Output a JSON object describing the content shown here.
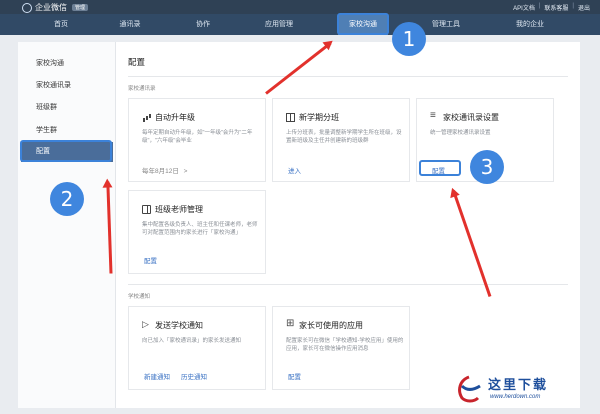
{
  "app": {
    "logo_text": "企业微信",
    "logo_badge": "管理",
    "top_links": [
      "API文档",
      "联系客服",
      "退出"
    ]
  },
  "nav": {
    "items": [
      "首页",
      "通讯录",
      "协作",
      "应用管理",
      "家校沟通",
      "管理工具",
      "我的企业"
    ],
    "active": "家校沟通"
  },
  "sidebar": {
    "items": [
      "家校沟通",
      "家校通讯录",
      "班级群",
      "学生群",
      "配置"
    ],
    "active": "配置"
  },
  "main": {
    "title": "配置",
    "section_contacts": "家校通讯录",
    "section_notice": "学校通知",
    "cards": {
      "promotion": {
        "title": "自动升年级",
        "desc": "每年定期自动升年级，如\"一年级\"会升为\"二年级\"，\"六年级\"会毕业",
        "foot": "每年8月12日",
        "foot_chevron": ">"
      },
      "class_split": {
        "title": "新学期分班",
        "desc": "上传分班表，批量调整新学期学生所在班级，设置新班级及主任并创建新的班级群",
        "link": "进入"
      },
      "contacts_settings": {
        "title": "家校通讯录设置",
        "desc": "统一管理家校通讯录设置",
        "link": "配置"
      },
      "class_teacher": {
        "title": "班级老师管理",
        "desc": "集中配置各级负责人、班主任和任课老师，老师可对配置范围内的家长进行「家校沟通」",
        "link": "配置"
      },
      "send_notice": {
        "title": "发送学校通知",
        "desc": "向已加入「家校通讯录」的家长发送通知",
        "link1": "新建通知",
        "link2": "历史通知"
      },
      "parent_apps": {
        "title": "家长可使用的应用",
        "desc": "配置家长可在微信「学校通知-学校应用」使用的应用，家长可在微信操作应用消息",
        "link": "配置"
      }
    }
  },
  "annotations": {
    "step1": "1",
    "step2": "2",
    "step3": "3",
    "highlight_color": "#3c82d9",
    "arrow_color": "#e2312c"
  },
  "watermark": {
    "text": "这里下载",
    "url": "www.herdown.com"
  },
  "colors": {
    "topbar": "#2f4155",
    "navbar": "#314a66",
    "nav_active": "#4f7fb5",
    "sidebar_active": "#4a6d9a",
    "link": "#3a72c4"
  }
}
